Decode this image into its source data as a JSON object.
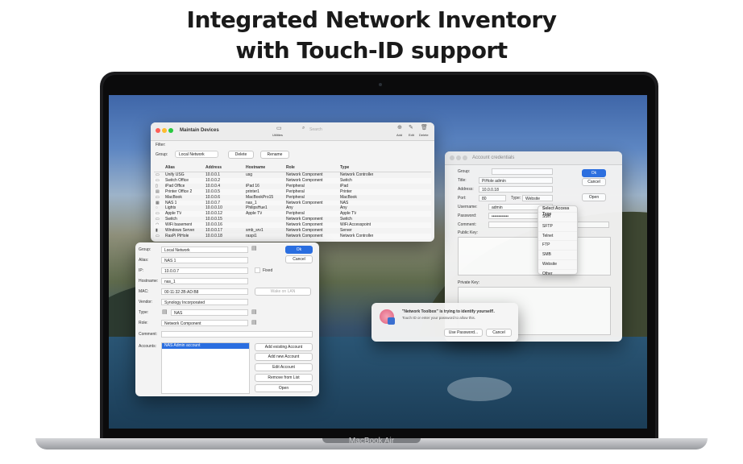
{
  "headline": {
    "line1": "Integrated Network Inventory",
    "line2": "with Touch-ID support"
  },
  "laptop": {
    "brand": "MacBook Air"
  },
  "maintain": {
    "title": "Maintain Devices",
    "toolbar": {
      "utilities": "Utilities",
      "search_placeholder": "Search",
      "add": "Add",
      "edit": "Edit",
      "delete": "Delete"
    },
    "filter_label": "Filter:",
    "group_label": "Group:",
    "group_value": "Local Network",
    "delete_button": "Delete",
    "rename_button": "Rename",
    "columns": [
      "Alias",
      "Address",
      "Hostname",
      "Role",
      "Type"
    ],
    "rows": [
      {
        "icon": "▭",
        "alias": "Unify USG",
        "address": "10.0.0.1",
        "hostname": "usg",
        "role": "Network Component",
        "type": "Network Controller"
      },
      {
        "icon": "▭",
        "alias": "Switch Office",
        "address": "10.0.0.2",
        "hostname": "",
        "role": "Network Component",
        "type": "Switch"
      },
      {
        "icon": "▯",
        "alias": "iPad Office",
        "address": "10.0.0.4",
        "hostname": "iPad 16",
        "role": "Peripheral",
        "type": "iPad"
      },
      {
        "icon": "▤",
        "alias": "Printer Office 2",
        "address": "10.0.0.5",
        "hostname": "printer1",
        "role": "Peripheral",
        "type": "Printer"
      },
      {
        "icon": "▭",
        "alias": "MacBook",
        "address": "10.0.0.6",
        "hostname": "MacBookPro15",
        "role": "Peripheral",
        "type": "MacBook"
      },
      {
        "icon": "▦",
        "alias": "NAS 1",
        "address": "10.0.0.7",
        "hostname": "nas_1",
        "role": "Network Component",
        "type": "NAS"
      },
      {
        "icon": "◌",
        "alias": "Lights",
        "address": "10.0.0.10",
        "hostname": "PhilipsHue1",
        "role": "Any",
        "type": "Any"
      },
      {
        "icon": "▭",
        "alias": "Apple TV",
        "address": "10.0.0.12",
        "hostname": "Apple TV",
        "role": "Peripheral",
        "type": "Apple TV"
      },
      {
        "icon": "▭",
        "alias": "Switch",
        "address": "10.0.0.15",
        "hostname": "",
        "role": "Network Component",
        "type": "Switch"
      },
      {
        "icon": "◠",
        "alias": "WiFi basement",
        "address": "10.0.0.16",
        "hostname": "",
        "role": "Network Component",
        "type": "WiFi Accesspoint"
      },
      {
        "icon": "▮",
        "alias": "Windows Server",
        "address": "10.0.0.17",
        "hostname": "smb_srv1",
        "role": "Network Component",
        "type": "Server"
      },
      {
        "icon": "▭",
        "alias": "RasPi PiHole",
        "address": "10.0.0.18",
        "hostname": "raspi1",
        "role": "Network Component",
        "type": "Network Controller"
      }
    ]
  },
  "detail": {
    "group_label": "Group:",
    "group_value": "Local Network",
    "alias_label": "Alias:",
    "alias_value": "NAS 1",
    "ip_label": "IP:",
    "ip_value": "10.0.0.7",
    "fixed_label": "Fixed",
    "hostname_label": "Hostname:",
    "hostname_value": "nas_1",
    "mac_label": "MAC:",
    "mac_value": "00:11:32:2B:AD:B8",
    "wake_button": "Wake on LAN",
    "vendor_label": "Vendor:",
    "vendor_value": "Synology Incorporated",
    "type_label": "Type:",
    "type_value": "NAS",
    "role_label": "Role:",
    "role_value": "Network Component",
    "comment_label": "Comment:",
    "accounts_label": "Accounts:",
    "account_selected": "NAS Admin account",
    "ok": "Ok",
    "cancel": "Cancel",
    "add_existing": "Add existing Account",
    "add_new": "Add new Account",
    "edit_account": "Edit Account",
    "remove": "Remove from List",
    "open": "Open"
  },
  "credentials": {
    "title": "Account credentials",
    "group_label": "Group:",
    "title_label": "Title:",
    "title_value": "PiHole admin",
    "address_label": "Address:",
    "address_value": "10.0.0.18",
    "port_label": "Port:",
    "port_value": "80",
    "type_label": "Type:",
    "type_value": "Website",
    "username_label": "Username:",
    "username_value": "admin",
    "password_label": "Password:",
    "password_value": "••••••••••••",
    "comment_label": "Comment:",
    "public_key_label": "Public Key:",
    "private_key_label": "Private Key:",
    "ok": "Ok",
    "cancel": "Cancel",
    "open": "Open",
    "popup_header": "Select Access Type",
    "popup_items": [
      "SSH",
      "SFTP",
      "Telnet",
      "FTP",
      "SMB",
      "Website",
      "Other"
    ]
  },
  "touchid": {
    "title": "\"Network Toolbox\" is trying to identify yourself!.",
    "message": "Touch ID or enter your password to allow this.",
    "use_password": "Use Password...",
    "cancel": "Cancel"
  },
  "colors": {
    "accent": "#2a6ee0",
    "close": "#fe5f57",
    "minimize": "#febc2e",
    "zoom": "#28c840"
  }
}
